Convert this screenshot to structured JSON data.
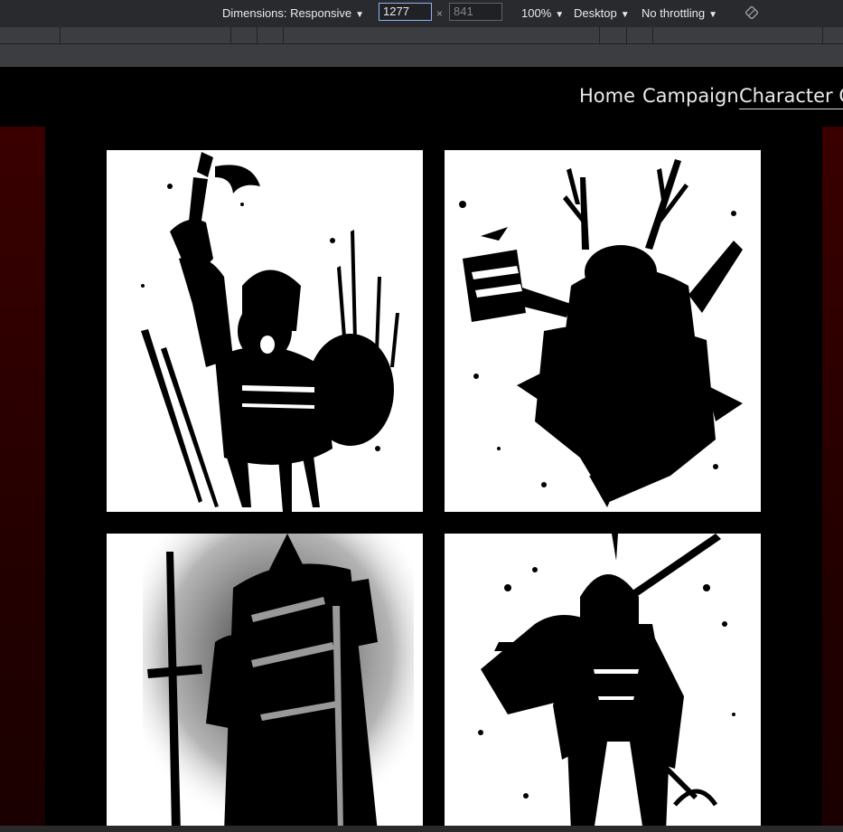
{
  "devtools": {
    "dimensions_label": "Dimensions: Responsive",
    "width_value": "1277",
    "height_placeholder": "841",
    "times_symbol": "×",
    "zoom": "100%",
    "device_type": "Desktop",
    "throttling": "No throttling",
    "rotate_icon": "rotate-icon"
  },
  "nav": {
    "items": [
      {
        "label": "Home"
      },
      {
        "label": "Campaign"
      },
      {
        "label": "Character Cre"
      }
    ]
  },
  "gallery": {
    "cards": [
      {
        "subject": "viking-warrior-with-axe-and-shield",
        "icon": "ink-splash-illustration"
      },
      {
        "subject": "druid-with-antlers-and-book",
        "icon": "ink-splash-illustration"
      },
      {
        "subject": "armored-knight-with-sword",
        "icon": "ink-splash-illustration"
      },
      {
        "subject": "hooded-rogue-with-crossbow",
        "icon": "ink-splash-illustration"
      }
    ]
  },
  "colors": {
    "background": "#000000",
    "side_panel": "#2a0000",
    "card": "#ffffff",
    "nav_text": "#eaeaea"
  }
}
